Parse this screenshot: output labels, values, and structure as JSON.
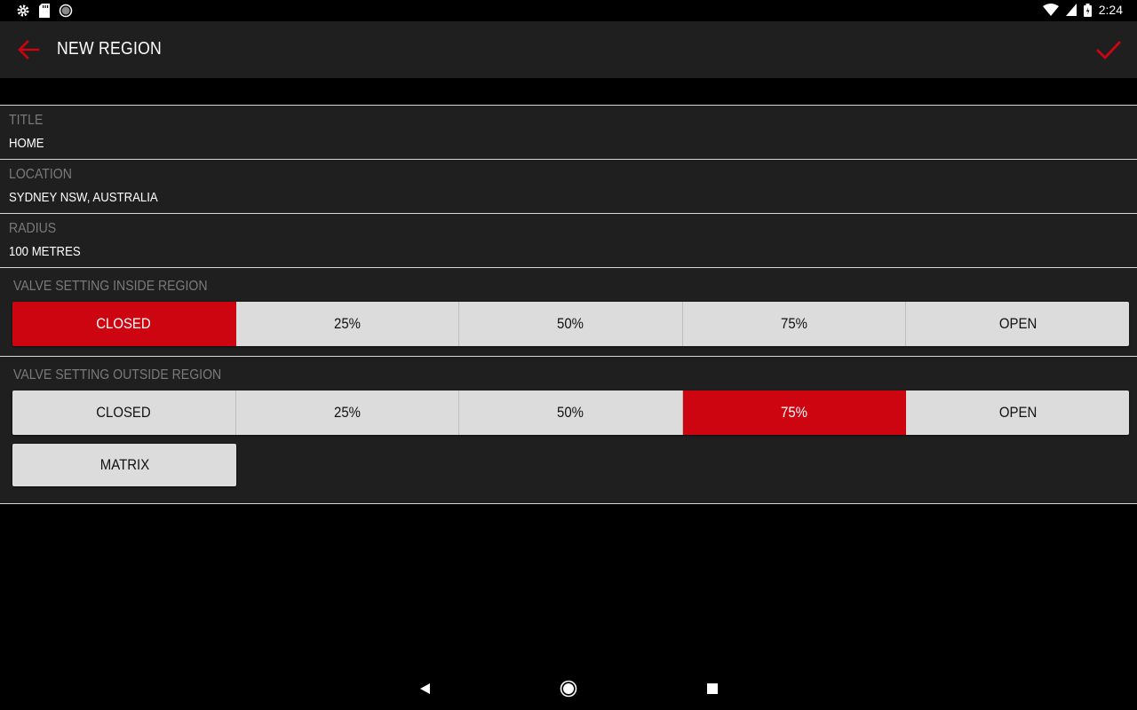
{
  "status_bar": {
    "time": "2:24",
    "left_icons": [
      "gear-icon",
      "sd-card-icon",
      "sync-icon"
    ],
    "right_icons": [
      "wifi-icon",
      "signal-icon",
      "battery-icon"
    ]
  },
  "app_bar": {
    "title": "NEW REGION",
    "back_icon": "arrow-left-icon",
    "confirm_icon": "check-icon"
  },
  "fields": {
    "title": {
      "label": "TITLE",
      "value": "HOME"
    },
    "location": {
      "label": "LOCATION",
      "value": "SYDNEY NSW, AUSTRALIA"
    },
    "radius": {
      "label": "RADIUS",
      "value": "100 METRES"
    }
  },
  "inside_region": {
    "label": "VALVE SETTING INSIDE REGION",
    "options": [
      "CLOSED",
      "25%",
      "50%",
      "75%",
      "OPEN"
    ],
    "selected": "CLOSED"
  },
  "outside_region": {
    "label": "VALVE SETTING OUTSIDE REGION",
    "options": [
      "CLOSED",
      "25%",
      "50%",
      "75%",
      "OPEN"
    ],
    "selected": "75%"
  },
  "matrix_button": {
    "label": "MATRIX"
  },
  "colors": {
    "accent": "#cc0511",
    "surface": "#1f1f1f",
    "background": "#000000",
    "button": "#dcdcdc",
    "label": "#7a7a7a"
  },
  "nav_bar": {
    "icons": [
      "nav-back-icon",
      "nav-home-icon",
      "nav-recents-icon"
    ]
  }
}
